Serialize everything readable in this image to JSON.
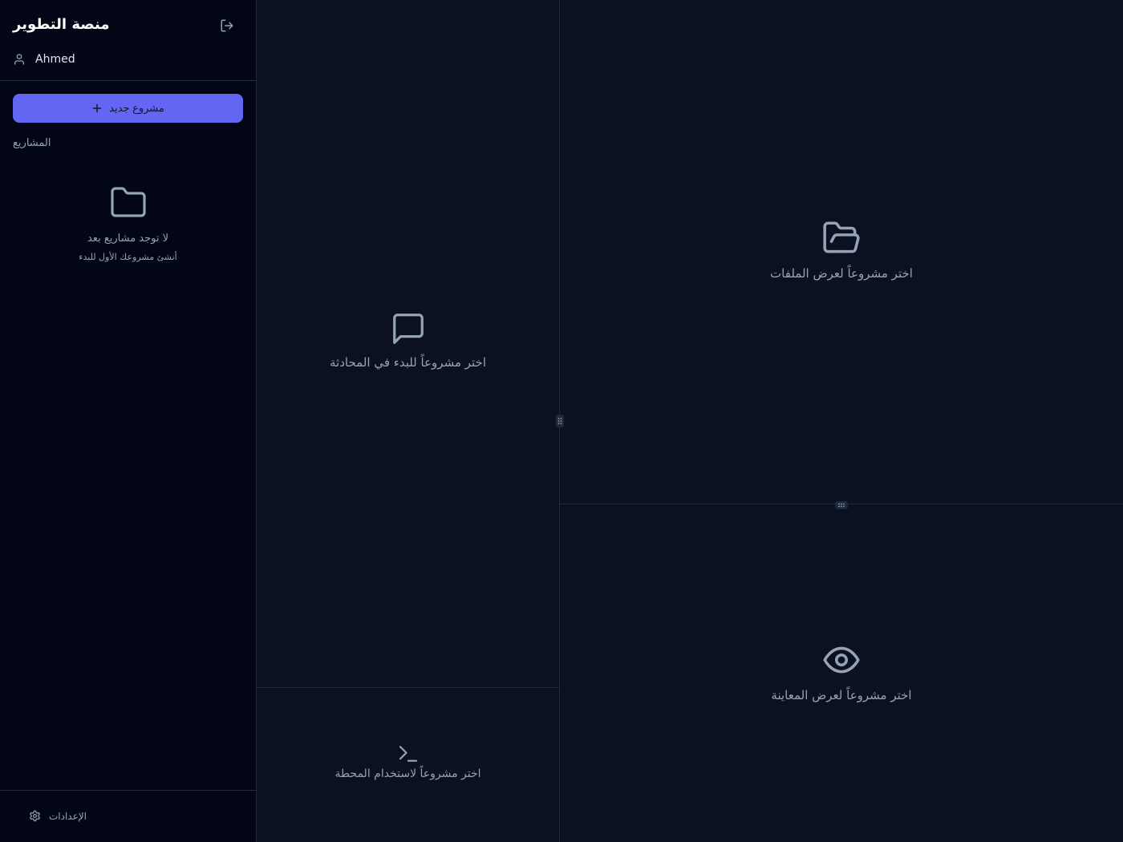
{
  "sidebar": {
    "app_title": "منصة التطوير",
    "user_name": "Ahmed",
    "new_project_label": "مشروع جديد",
    "projects_heading": "المشاريع",
    "empty_title": "لا توجد مشاريع بعد",
    "empty_subtitle": "أنشئ مشروعك الأول للبدء",
    "settings_label": "الإعدادات"
  },
  "panes": {
    "chat_placeholder": "اختر مشروعاً للبدء في المحادثة",
    "terminal_placeholder": "اختر مشروعاً لاستخدام المحطة",
    "files_placeholder": "اختر مشروعاً لعرض الملفات",
    "preview_placeholder": "اختر مشروعاً لعرض المعاينة"
  },
  "icons": {
    "logout": "logout-icon",
    "user": "user-icon",
    "plus": "plus-icon",
    "folder": "folder-icon",
    "settings": "gear-icon",
    "chat": "message-square-icon",
    "terminal": "terminal-icon",
    "files": "folder-open-icon",
    "preview": "eye-icon"
  },
  "colors": {
    "accent": "#6366f1",
    "background": "#0b1120",
    "sidebar_background": "#020617",
    "border": "#1e293b",
    "muted_text": "#94a3b8"
  }
}
